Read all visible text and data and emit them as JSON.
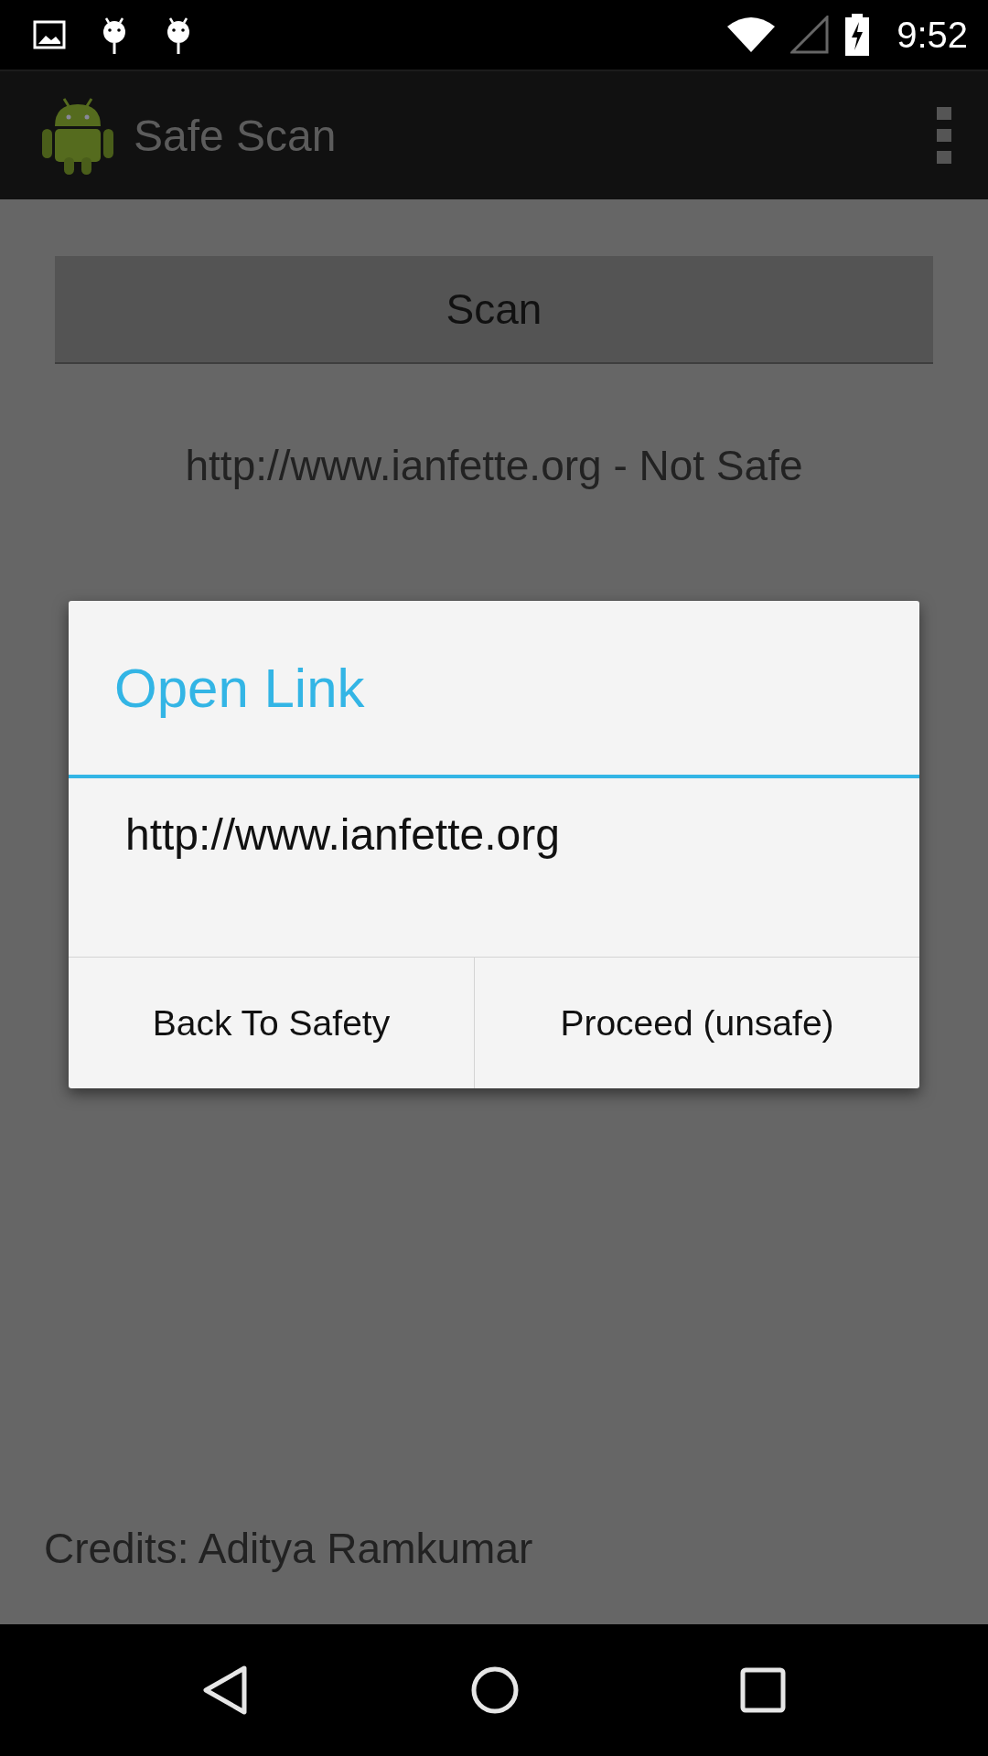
{
  "status_bar": {
    "time": "9:52"
  },
  "app_bar": {
    "title": "Safe Scan"
  },
  "scan_button": {
    "label": "Scan"
  },
  "result": "http://www.ianfette.org - Not Safe",
  "dialog": {
    "title": "Open Link",
    "message": "http://www.ianfette.org",
    "buttons": [
      "Back To Safety",
      "Proceed (unsafe)"
    ]
  },
  "credits": "Credits: Aditya Ramkumar"
}
